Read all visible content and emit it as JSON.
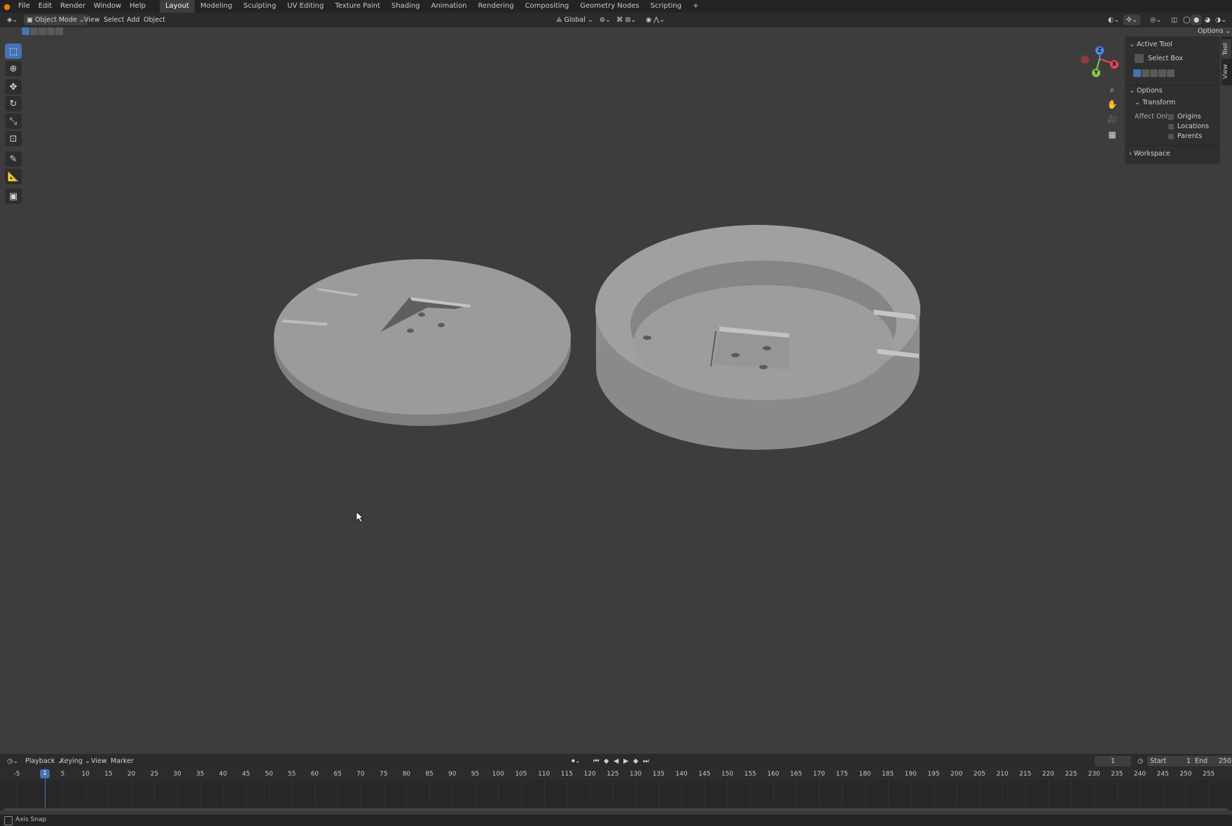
{
  "top_menu": {
    "items": [
      "File",
      "Edit",
      "Render",
      "Window",
      "Help"
    ],
    "workspace_tabs": [
      "Layout",
      "Modeling",
      "Sculpting",
      "UV Editing",
      "Texture Paint",
      "Shading",
      "Animation",
      "Rendering",
      "Compositing",
      "Geometry Nodes",
      "Scripting"
    ],
    "active_tab": "Layout",
    "add_tab": "+"
  },
  "header": {
    "mode": "Object Mode",
    "menus": [
      "View",
      "Select",
      "Add",
      "Object"
    ],
    "orientation": "Global",
    "options": "Options"
  },
  "toolbar": {
    "tools": [
      "select-box",
      "cursor",
      "move",
      "rotate",
      "scale",
      "transform",
      "annotate",
      "measure",
      "add-cube"
    ]
  },
  "side_panel": {
    "active_tool_label": "Active Tool",
    "tool_name": "Select Box",
    "options_label": "Options",
    "transform_label": "Transform",
    "affect_only_label": "Affect Only",
    "affect_items": [
      "Origins",
      "Locations",
      "Parents"
    ],
    "workspace_label": "Workspace",
    "tabs": [
      "Tool",
      "View"
    ]
  },
  "gizmo": {
    "z": "Z",
    "y": "Y",
    "x": "X"
  },
  "timeline_header": {
    "menus": [
      "Playback",
      "Keying",
      "View",
      "Marker"
    ],
    "current_frame": "1",
    "start_label": "Start",
    "start_value": "1",
    "end_label": "End",
    "end_value": "250"
  },
  "timeline": {
    "current_frame": 1,
    "frames": [
      "-5",
      "1",
      "5",
      "10",
      "15",
      "20",
      "25",
      "30",
      "35",
      "40",
      "45",
      "50",
      "55",
      "60",
      "65",
      "70",
      "75",
      "80",
      "85",
      "90",
      "95",
      "100",
      "105",
      "110",
      "115",
      "120",
      "125",
      "130",
      "135",
      "140",
      "145",
      "150",
      "155",
      "160",
      "165",
      "170",
      "175",
      "180",
      "185",
      "190",
      "195",
      "200",
      "205",
      "210",
      "215",
      "220",
      "225",
      "230",
      "235",
      "240",
      "245",
      "250",
      "255"
    ]
  },
  "status": {
    "text": "Axis Snap"
  },
  "colors": {
    "accent": "#4772b3",
    "x_axis": "#e8475a",
    "y_axis": "#8bc34a",
    "z_axis": "#4a8cf0"
  }
}
